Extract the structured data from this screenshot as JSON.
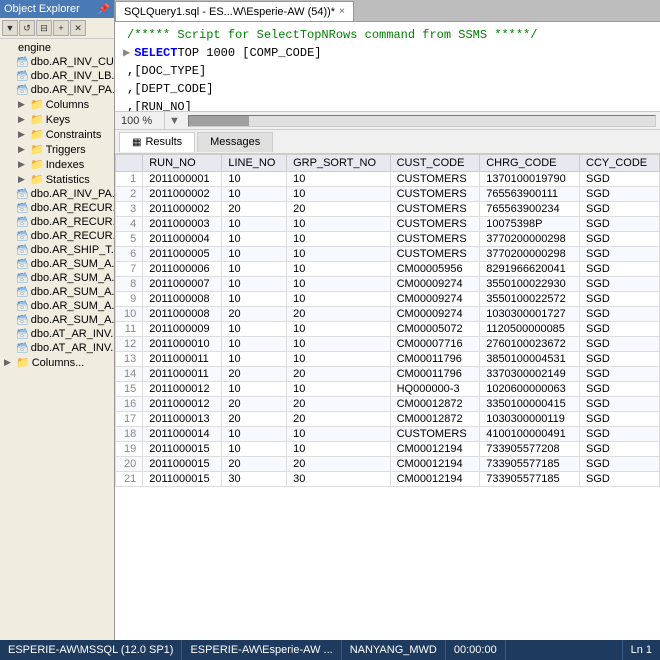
{
  "titleBar": {
    "label": ""
  },
  "sidebar": {
    "title": "Object Explorer",
    "toolbar": [
      "filter",
      "refresh",
      "collapse"
    ],
    "items": [
      {
        "id": "engine",
        "label": "engine",
        "indent": 0,
        "type": "text",
        "arrow": ""
      },
      {
        "id": "ar_inv_cu",
        "label": "dbo.AR_INV_CU...",
        "indent": 0,
        "type": "table",
        "arrow": ""
      },
      {
        "id": "ar_inv_lb",
        "label": "dbo.AR_INV_LB...",
        "indent": 0,
        "type": "table",
        "arrow": ""
      },
      {
        "id": "ar_inv_pa",
        "label": "dbo.AR_INV_PA...",
        "indent": 0,
        "type": "table",
        "arrow": ""
      },
      {
        "id": "columns",
        "label": "Columns",
        "indent": 1,
        "type": "folder",
        "arrow": "▶"
      },
      {
        "id": "keys",
        "label": "Keys",
        "indent": 1,
        "type": "folder",
        "arrow": "▶"
      },
      {
        "id": "constraints",
        "label": "Constraints",
        "indent": 1,
        "type": "folder",
        "arrow": "▶"
      },
      {
        "id": "triggers",
        "label": "Triggers",
        "indent": 1,
        "type": "folder",
        "arrow": "▶"
      },
      {
        "id": "indexes",
        "label": "Indexes",
        "indent": 1,
        "type": "folder",
        "arrow": "▶"
      },
      {
        "id": "statistics",
        "label": "Statistics",
        "indent": 1,
        "type": "folder",
        "arrow": "▶"
      },
      {
        "id": "ar_inv_pa2",
        "label": "dbo.AR_INV_PA...",
        "indent": 0,
        "type": "table",
        "arrow": ""
      },
      {
        "id": "ar_recur1",
        "label": "dbo.AR_RECUR...",
        "indent": 0,
        "type": "table",
        "arrow": ""
      },
      {
        "id": "ar_recur2",
        "label": "dbo.AR_RECUR...",
        "indent": 0,
        "type": "table",
        "arrow": ""
      },
      {
        "id": "ar_recur3",
        "label": "dbo.AR_RECUR...",
        "indent": 0,
        "type": "table",
        "arrow": ""
      },
      {
        "id": "ar_ship",
        "label": "dbo.AR_SHIP_T...",
        "indent": 0,
        "type": "table",
        "arrow": ""
      },
      {
        "id": "ar_sum1",
        "label": "dbo.AR_SUM_A...",
        "indent": 0,
        "type": "table",
        "arrow": ""
      },
      {
        "id": "ar_sum2",
        "label": "dbo.AR_SUM_A...",
        "indent": 0,
        "type": "table",
        "arrow": ""
      },
      {
        "id": "ar_sum3",
        "label": "dbo.AR_SUM_A...",
        "indent": 0,
        "type": "table",
        "arrow": ""
      },
      {
        "id": "ar_sum4",
        "label": "dbo.AR_SUM_A...",
        "indent": 0,
        "type": "table",
        "arrow": ""
      },
      {
        "id": "ar_sum5",
        "label": "dbo.AR_SUM_A...",
        "indent": 0,
        "type": "table",
        "arrow": ""
      },
      {
        "id": "ar_inv2",
        "label": "dbo.AT_AR_INV...",
        "indent": 0,
        "type": "table",
        "arrow": ""
      },
      {
        "id": "at_ar_inv",
        "label": "dbo.AT_AR_INV...",
        "indent": 0,
        "type": "table",
        "arrow": ""
      },
      {
        "id": "columns2",
        "label": "Columns...",
        "indent": 0,
        "type": "folder",
        "arrow": "▶"
      }
    ]
  },
  "tab": {
    "label": "SQLQuery1.sql - ES...W\\Esperie-AW (54))*",
    "closeLabel": "×"
  },
  "editor": {
    "lines": [
      {
        "type": "comment",
        "text": "/***** Script for SelectTopNRows command from SSMS *****/"
      },
      {
        "type": "code",
        "text": "SELECT TOP 1000 [COMP_CODE]"
      },
      {
        "type": "code",
        "text": "      ,[DOC_TYPE]"
      },
      {
        "type": "code",
        "text": "      ,[DEPT_CODE]"
      },
      {
        "type": "code",
        "text": "      ,[RUN_NO]"
      }
    ]
  },
  "scrollbar": {
    "percent": "100 %"
  },
  "resultsTabs": [
    {
      "id": "results",
      "label": "Results",
      "icon": "▦"
    },
    {
      "id": "messages",
      "label": "Messages",
      "icon": ""
    }
  ],
  "table": {
    "columns": [
      "",
      "RUN_NO",
      "LINE_NO",
      "GRP_SORT_NO",
      "CUST_CODE",
      "CHRG_CODE",
      "CCY_CODE"
    ],
    "rows": [
      [
        "1",
        "2011000001",
        "10",
        "10",
        "CUSTOMERS",
        "1370100019790",
        "SGD"
      ],
      [
        "2",
        "2011000002",
        "10",
        "10",
        "CUSTOMERS",
        "765563900111",
        "SGD"
      ],
      [
        "3",
        "2011000002",
        "20",
        "20",
        "CUSTOMERS",
        "765563900234",
        "SGD"
      ],
      [
        "4",
        "2011000003",
        "10",
        "10",
        "CUSTOMERS",
        "10075398P",
        "SGD"
      ],
      [
        "5",
        "2011000004",
        "10",
        "10",
        "CUSTOMERS",
        "3770200000298",
        "SGD"
      ],
      [
        "6",
        "2011000005",
        "10",
        "10",
        "CUSTOMERS",
        "3770200000298",
        "SGD"
      ],
      [
        "7",
        "2011000006",
        "10",
        "10",
        "CM00005956",
        "8291966620041",
        "SGD"
      ],
      [
        "8",
        "2011000007",
        "10",
        "10",
        "CM00009274",
        "3550100022930",
        "SGD"
      ],
      [
        "9",
        "2011000008",
        "10",
        "10",
        "CM00009274",
        "3550100022572",
        "SGD"
      ],
      [
        "10",
        "2011000008",
        "20",
        "20",
        "CM00009274",
        "1030300001727",
        "SGD"
      ],
      [
        "11",
        "2011000009",
        "10",
        "10",
        "CM00005072",
        "1120500000085",
        "SGD"
      ],
      [
        "12",
        "2011000010",
        "10",
        "10",
        "CM00007716",
        "2760100023672",
        "SGD"
      ],
      [
        "13",
        "2011000011",
        "10",
        "10",
        "CM00011796",
        "3850100004531",
        "SGD"
      ],
      [
        "14",
        "2011000011",
        "20",
        "20",
        "CM00011796",
        "3370300002149",
        "SGD"
      ],
      [
        "15",
        "2011000012",
        "10",
        "10",
        "HQ000000-3",
        "1020600000063",
        "SGD"
      ],
      [
        "16",
        "2011000012",
        "20",
        "20",
        "CM00012872",
        "3350100000415",
        "SGD"
      ],
      [
        "17",
        "2011000013",
        "20",
        "20",
        "CM00012872",
        "1030300000119",
        "SGD"
      ],
      [
        "18",
        "2011000014",
        "10",
        "10",
        "CUSTOMERS",
        "4100100000491",
        "SGD"
      ],
      [
        "19",
        "2011000015",
        "10",
        "10",
        "CM00012194",
        "733905577208",
        "SGD"
      ],
      [
        "20",
        "2011000015",
        "20",
        "20",
        "CM00012194",
        "733905577185",
        "SGD"
      ],
      [
        "21",
        "2011000015",
        "30",
        "30",
        "CM00012194",
        "733905577185",
        "SGD"
      ]
    ]
  },
  "statusBar": {
    "server": "ESPERIE-AW\\MSSQL (12.0 SP1)",
    "connection": "ESPERIE-AW\\Esperie-AW ...",
    "db": "NANYANG_MWD",
    "time": "00:00:00",
    "rows": "",
    "position": "Ln 1"
  }
}
